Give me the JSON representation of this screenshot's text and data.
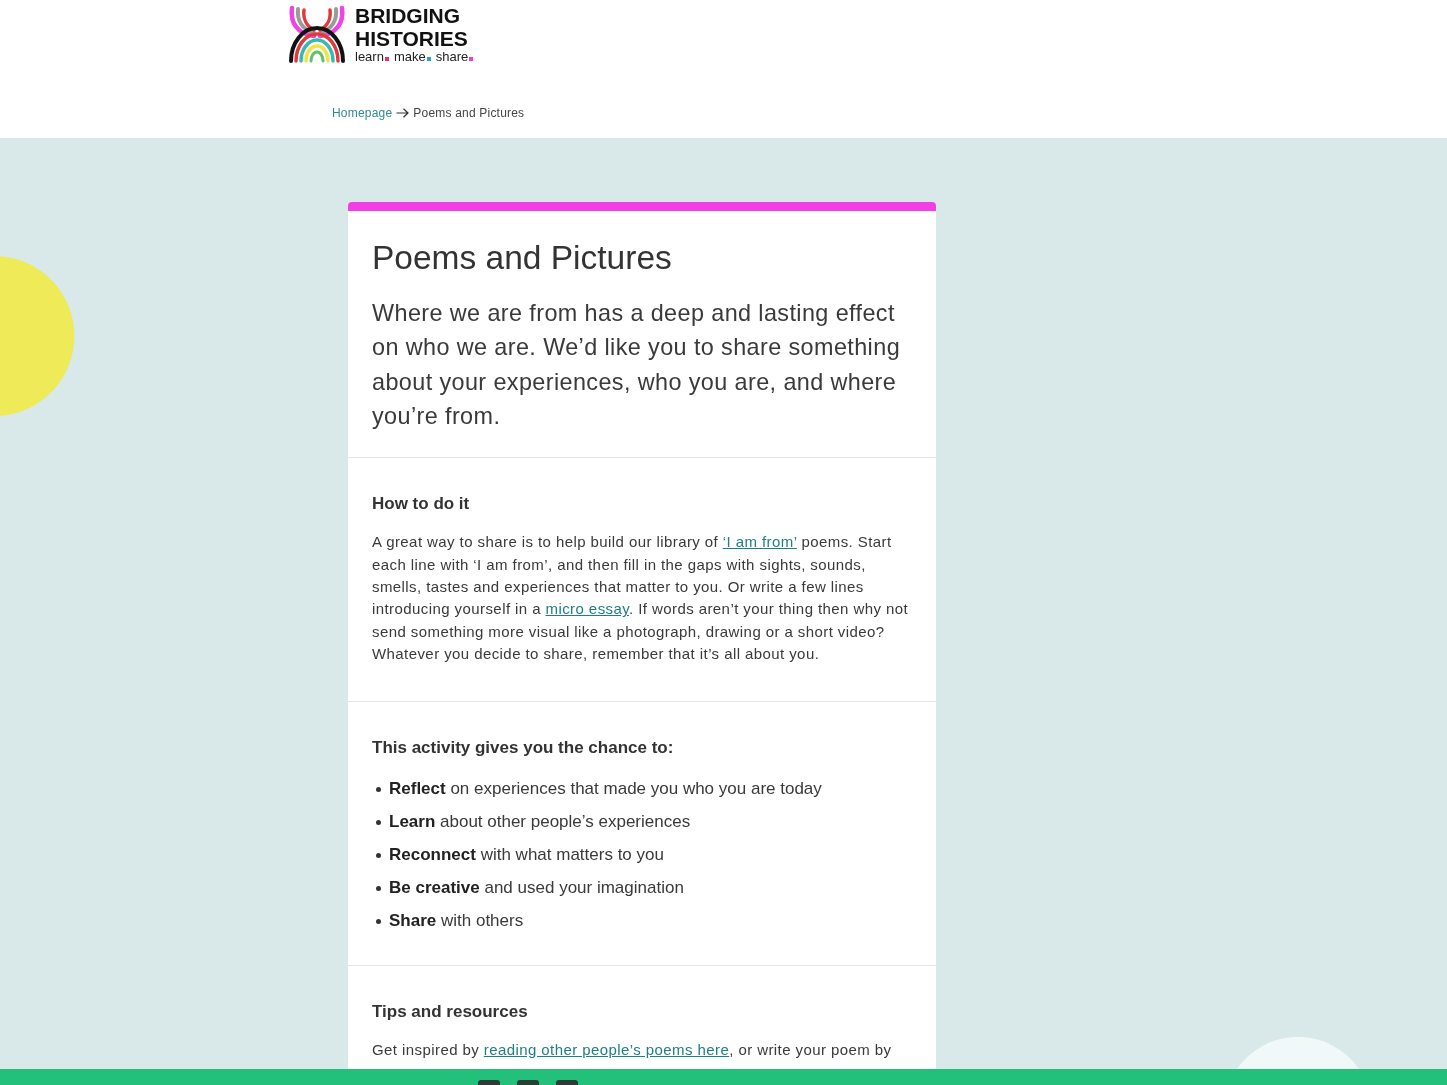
{
  "header": {
    "logo": {
      "title_lines": [
        "BRIDGING",
        "HISTORIES"
      ],
      "tagline": [
        {
          "word": "learn",
          "color": "#e5336b"
        },
        {
          "word": "make",
          "color": "#2aa8b0"
        },
        {
          "word": "share",
          "color": "#e93fd6"
        }
      ]
    },
    "breadcrumb": [
      {
        "label": "Homepage",
        "kind": "link"
      },
      {
        "label": "Poems and Pictures",
        "kind": "current"
      }
    ]
  },
  "card": {
    "title": "Poems and Pictures",
    "intro": "Where we are from has a deep and lasting effect on who we are. We’d like you to share something about your experiences, who you are, and where you’re from.",
    "sections": [
      {
        "kind": "paragraph",
        "heading": "How to do it",
        "segments": [
          {
            "kind": "text",
            "text": "A great way to share is to help build our library of "
          },
          {
            "kind": "link",
            "text": "‘I am from’"
          },
          {
            "kind": "text",
            "text": " poems. Start each line with ‘I am from’, and then fill in the gaps with sights, sounds, smells, tastes and experiences that matter to you. Or write a few lines introducing yourself in a "
          },
          {
            "kind": "link",
            "text": "micro essay"
          },
          {
            "kind": "text",
            "text": ". If words aren’t your thing then why not send something more visual like a photograph, drawing or a short video? Whatever you decide to share, remember that it’s all about you."
          }
        ]
      },
      {
        "kind": "list",
        "heading": "This activity gives you the chance to:",
        "items": [
          "**Reflect** on experiences that made you who you are today",
          "**Learn** about other people’s experiences",
          "**Reconnect** with what matters to you",
          "**Be creative** and used your imagination",
          "**Share** with others"
        ]
      },
      {
        "kind": "paragraph",
        "heading": "Tips and resources",
        "segments": [
          {
            "kind": "text",
            "text": "Get inspired by "
          },
          {
            "kind": "link",
            "text": "reading other people’s poems here"
          },
          {
            "kind": "text",
            "text": ", or write your poem by"
          }
        ]
      }
    ]
  }
}
